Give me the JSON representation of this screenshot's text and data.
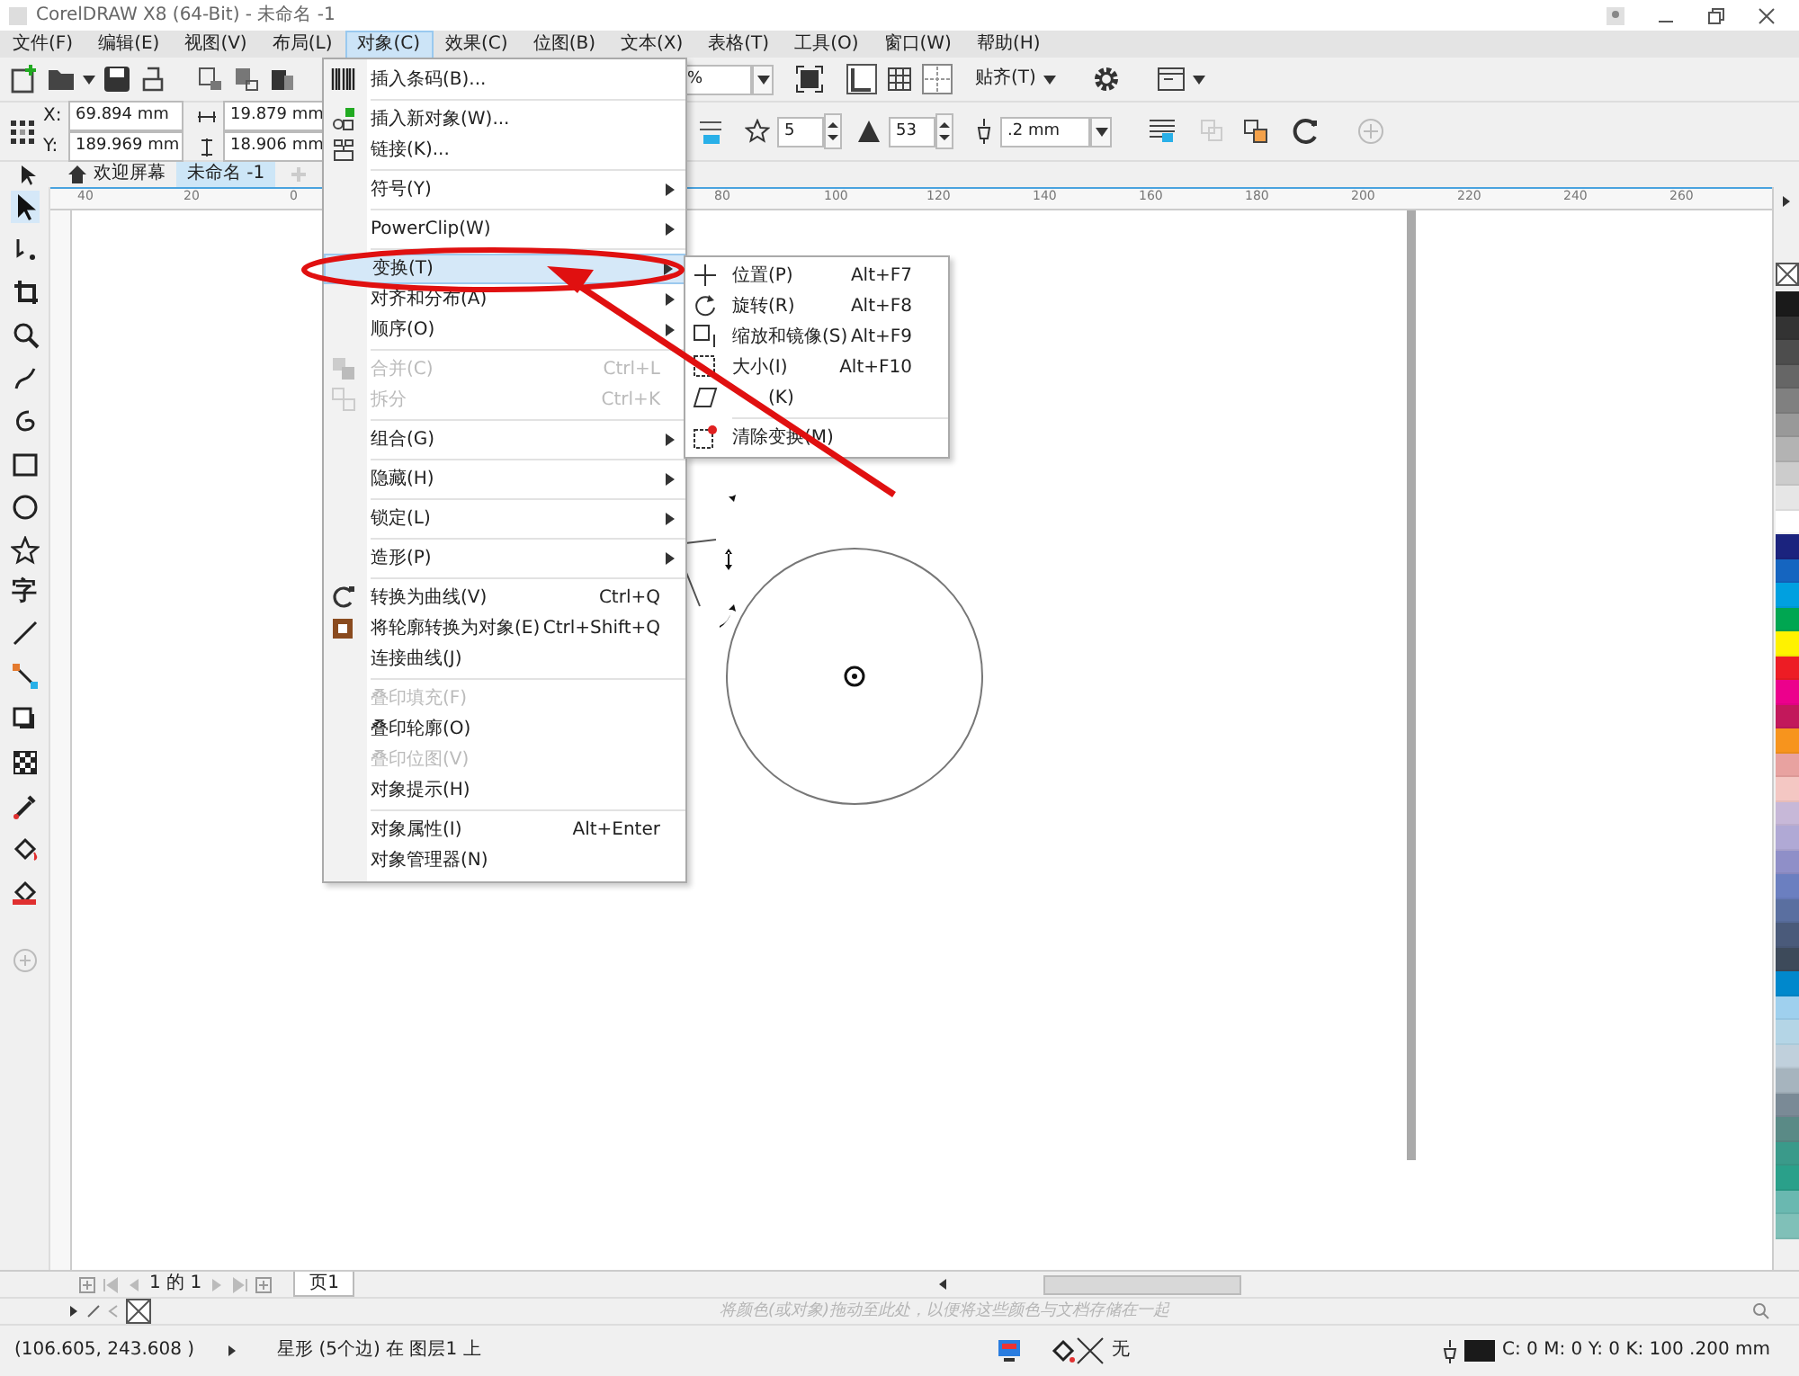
{
  "window": {
    "title": "CorelDRAW X8 (64-Bit) - 未命名 -1"
  },
  "menu_bar": [
    {
      "label": "文件(F)",
      "selected": false
    },
    {
      "label": "编辑(E)",
      "selected": false
    },
    {
      "label": "视图(V)",
      "selected": false
    },
    {
      "label": "布局(L)",
      "selected": false
    },
    {
      "label": "对象(C)",
      "selected": true
    },
    {
      "label": "效果(C)",
      "selected": false
    },
    {
      "label": "位图(B)",
      "selected": false
    },
    {
      "label": "文本(X)",
      "selected": false
    },
    {
      "label": "表格(T)",
      "selected": false
    },
    {
      "label": "工具(O)",
      "selected": false
    },
    {
      "label": "窗口(W)",
      "selected": false
    },
    {
      "label": "帮助(H)",
      "selected": false
    }
  ],
  "standard_toolbar": {
    "zoom_value": "%",
    "snap_label": "贴齐(T)"
  },
  "property_bar": {
    "x_label": "X:",
    "x_value": "69.894 mm",
    "y_label": "Y:",
    "y_value": "189.969 mm",
    "width_value": "19.879 mm",
    "height_value": "18.906 mm",
    "points_value": "5",
    "sharpness_value": "53",
    "outline_width": ".2 mm"
  },
  "document_tabs": [
    {
      "label": "欢迎屏幕",
      "selected": false
    },
    {
      "label": "未命名 -1",
      "selected": true
    }
  ],
  "toolbox": {
    "text_tool_glyph": "字"
  },
  "top_ruler": {
    "labels": [
      "40",
      "20",
      "0",
      "80",
      "100",
      "120",
      "140",
      "160",
      "180",
      "200",
      "220",
      "240",
      "260"
    ]
  },
  "object_menu": {
    "items": [
      {
        "kind": "item",
        "label": "插入条码(B)...",
        "submenu": false,
        "disabled": false,
        "selected": false
      },
      {
        "kind": "separator"
      },
      {
        "kind": "item",
        "label": "插入新对象(W)...",
        "submenu": false,
        "disabled": false,
        "selected": false
      },
      {
        "kind": "item",
        "label": "链接(K)...",
        "submenu": false,
        "disabled": false,
        "selected": false
      },
      {
        "kind": "separator"
      },
      {
        "kind": "item",
        "label": "符号(Y)",
        "submenu": true,
        "disabled": false,
        "selected": false
      },
      {
        "kind": "separator"
      },
      {
        "kind": "item",
        "label": "PowerClip(W)",
        "submenu": true,
        "disabled": false,
        "selected": false
      },
      {
        "kind": "separator"
      },
      {
        "kind": "item",
        "label": "变换(T)",
        "submenu": true,
        "disabled": false,
        "selected": true
      },
      {
        "kind": "item",
        "label": "对齐和分布(A)",
        "submenu": true,
        "disabled": false,
        "selected": false
      },
      {
        "kind": "item",
        "label": "顺序(O)",
        "submenu": true,
        "disabled": false,
        "selected": false
      },
      {
        "kind": "separator"
      },
      {
        "kind": "item",
        "label": "合并(C)",
        "shortcut": "Ctrl+L",
        "submenu": false,
        "disabled": true,
        "selected": false
      },
      {
        "kind": "item",
        "label": "拆分",
        "shortcut": "Ctrl+K",
        "submenu": false,
        "disabled": true,
        "selected": false
      },
      {
        "kind": "separator"
      },
      {
        "kind": "item",
        "label": "组合(G)",
        "submenu": true,
        "disabled": false,
        "selected": false
      },
      {
        "kind": "separator"
      },
      {
        "kind": "item",
        "label": "隐藏(H)",
        "submenu": true,
        "disabled": false,
        "selected": false
      },
      {
        "kind": "separator"
      },
      {
        "kind": "item",
        "label": "锁定(L)",
        "submenu": true,
        "disabled": false,
        "selected": false
      },
      {
        "kind": "separator"
      },
      {
        "kind": "item",
        "label": "造形(P)",
        "submenu": true,
        "disabled": false,
        "selected": false
      },
      {
        "kind": "separator"
      },
      {
        "kind": "item",
        "label": "转换为曲线(V)",
        "shortcut": "Ctrl+Q",
        "submenu": false,
        "disabled": false,
        "selected": false
      },
      {
        "kind": "item",
        "label": "将轮廓转换为对象(E)",
        "shortcut": "Ctrl+Shift+Q",
        "submenu": false,
        "disabled": false,
        "selected": false
      },
      {
        "kind": "item",
        "label": "连接曲线(J)",
        "submenu": false,
        "disabled": false,
        "selected": false
      },
      {
        "kind": "separator"
      },
      {
        "kind": "item",
        "label": "叠印填充(F)",
        "submenu": false,
        "disabled": true,
        "selected": false
      },
      {
        "kind": "item",
        "label": "叠印轮廓(O)",
        "submenu": false,
        "disabled": false,
        "selected": false
      },
      {
        "kind": "item",
        "label": "叠印位图(V)",
        "submenu": false,
        "disabled": true,
        "selected": false
      },
      {
        "kind": "item",
        "label": "对象提示(H)",
        "submenu": false,
        "disabled": false,
        "selected": false
      },
      {
        "kind": "separator"
      },
      {
        "kind": "item",
        "label": "对象属性(I)",
        "shortcut": "Alt+Enter",
        "submenu": false,
        "disabled": false,
        "selected": false
      },
      {
        "kind": "item",
        "label": "对象管理器(N)",
        "submenu": false,
        "disabled": false,
        "selected": false
      }
    ]
  },
  "transform_submenu": {
    "items": [
      {
        "kind": "item",
        "label": "位置(P)",
        "shortcut": "Alt+F7"
      },
      {
        "kind": "item",
        "label": "旋转(R)",
        "shortcut": "Alt+F8"
      },
      {
        "kind": "item",
        "label": "缩放和镜像(S)",
        "shortcut": "Alt+F9"
      },
      {
        "kind": "item",
        "label": "大小(I)",
        "shortcut": "Alt+F10"
      },
      {
        "kind": "item",
        "label": "(K)"
      },
      {
        "kind": "separator"
      },
      {
        "kind": "item",
        "label": "清除变换(M)"
      }
    ]
  },
  "color_palette": [
    {
      "color": "#1a1a1a"
    },
    {
      "color": "#333333"
    },
    {
      "color": "#4d4d4d"
    },
    {
      "color": "#666666"
    },
    {
      "color": "#808080"
    },
    {
      "color": "#999999"
    },
    {
      "color": "#b3b3b3"
    },
    {
      "color": "#cccccc"
    },
    {
      "color": "#e6e6e6"
    },
    {
      "color": "#ffffff"
    },
    {
      "color": "#1b237e"
    },
    {
      "color": "#1565c0"
    },
    {
      "color": "#00a0e0"
    },
    {
      "color": "#00a651"
    },
    {
      "color": "#fff200"
    },
    {
      "color": "#ed1c24"
    },
    {
      "color": "#ec008c"
    },
    {
      "color": "#c2185b"
    },
    {
      "color": "#f7941d"
    },
    {
      "color": "#e8a2a0"
    },
    {
      "color": "#f4c7c3"
    },
    {
      "color": "#c7b8d8"
    },
    {
      "color": "#b0a9d5"
    },
    {
      "color": "#8f8fc8"
    },
    {
      "color": "#6b7fc0"
    },
    {
      "color": "#5a6fa0"
    },
    {
      "color": "#4a5a7a"
    },
    {
      "color": "#3d4a5a"
    },
    {
      "color": "#0088cc"
    },
    {
      "color": "#9fd0ee"
    },
    {
      "color": "#b4d5e6"
    },
    {
      "color": "#c0d0dc"
    },
    {
      "color": "#a6b4be"
    },
    {
      "color": "#7a8a96"
    },
    {
      "color": "#5a8a86"
    },
    {
      "color": "#3a9a8a"
    },
    {
      "color": "#2aa08a"
    },
    {
      "color": "#6ab8b0"
    },
    {
      "color": "#80c0b8"
    }
  ],
  "page_navigator": {
    "page_count": "1 的 1",
    "page_tab": "页1"
  },
  "document_palette": {
    "hint": "将颜色(或对象)拖动至此处，以便将这些颜色与文档存储在一起"
  },
  "status_bar": {
    "cursor_position": "(106.605, 243.608 )",
    "selection_info": "星形 (5个边) 在 图层1 上",
    "fill_label": "无",
    "outline_info": "C: 0 M: 0 Y: 0 K: 100 .200 mm"
  }
}
